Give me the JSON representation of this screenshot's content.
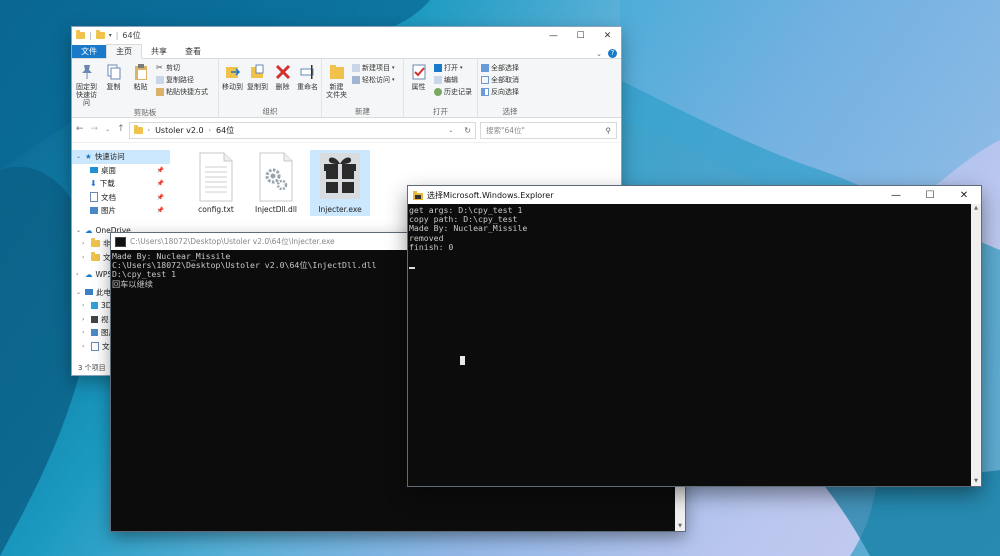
{
  "explorer": {
    "window_title": "64位",
    "tabs": [
      "文件",
      "主页",
      "共享",
      "查看"
    ],
    "ribbon": {
      "clipboard": {
        "pin_label": "固定到\n快速访问",
        "copy_label": "复制",
        "paste_label": "粘贴",
        "cut_label": "剪切",
        "copy_path_label": "复制路径",
        "paste_shortcut_label": "粘贴快捷方式",
        "group_label": "剪贴板"
      },
      "organize": {
        "move_to_label": "移动到",
        "copy_to_label": "复制到",
        "delete_label": "删除",
        "rename_label": "重命名",
        "group_label": "组织"
      },
      "new": {
        "new_folder_label": "新建\n文件夹",
        "new_item_label": "新建项目",
        "easy_access_label": "轻松访问",
        "group_label": "新建"
      },
      "open": {
        "properties_label": "属性",
        "open_label": "打开",
        "edit_label": "编辑",
        "history_label": "历史记录",
        "group_label": "打开"
      },
      "select": {
        "select_all_label": "全部选择",
        "select_none_label": "全部取消",
        "invert_label": "反向选择",
        "group_label": "选择"
      }
    },
    "address": {
      "crumbs": [
        "Ustoler v2.0",
        "64位"
      ],
      "search_placeholder": "搜索\"64位\""
    },
    "nav": {
      "quick_access": "快速访问",
      "items": [
        "桌面",
        "下载",
        "文档",
        "图片"
      ],
      "onedrive": "OneDrive",
      "onedrive_children": [
        "非",
        "文"
      ],
      "wps": "WPS",
      "this_pc": "此电",
      "pc_children": [
        "3D",
        "视",
        "图片",
        "文档"
      ]
    },
    "files": [
      {
        "name": "config.txt",
        "icon": "text-file-icon"
      },
      {
        "name": "InjectDll.dll",
        "icon": "dll-gear-icon"
      },
      {
        "name": "Injecter.exe",
        "icon": "gift-box-exe-icon"
      }
    ],
    "status": "3 个项目"
  },
  "console_injecter": {
    "title": "C:\\Users\\18072\\Desktop\\Ustoler v2.0\\64位\\Injecter.exe",
    "lines": "Made By: Nuclear_Missile\nC:\\Users\\18072\\Desktop\\Ustoler v2.0\\64位\\InjectDll.dll\nD:\\cpy_test 1\n回车以继续"
  },
  "console_explorer": {
    "title": "选择Microsoft.Windows.Explorer",
    "lines": "get args: D:\\cpy_test 1\ncopy path: D:\\cpy_test\nMade By: Nuclear_Missile\nremoved\nfinish: 0"
  },
  "colors": {
    "accent": "#1979ca",
    "selection": "#cce8ff",
    "console_bg": "#0c0c0c"
  }
}
